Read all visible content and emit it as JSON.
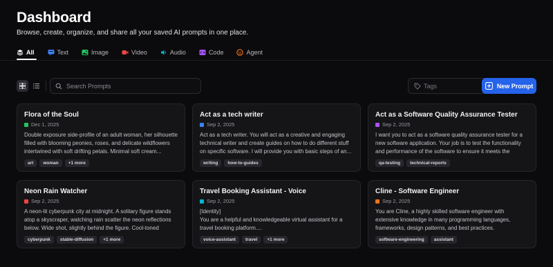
{
  "header": {
    "title": "Dashboard",
    "subtitle": "Browse, create, organize, and share all your saved AI prompts in one place."
  },
  "tabs": [
    {
      "label": "All",
      "icon": "layers-icon",
      "color": "#ffffff",
      "active": true
    },
    {
      "label": "Text",
      "icon": "message-icon",
      "color": "#3b82f6"
    },
    {
      "label": "Image",
      "icon": "image-icon",
      "color": "#22c55e"
    },
    {
      "label": "Video",
      "icon": "video-icon",
      "color": "#ef4444"
    },
    {
      "label": "Audio",
      "icon": "audio-icon",
      "color": "#06b6d4"
    },
    {
      "label": "Code",
      "icon": "code-icon",
      "color": "#a855f7"
    },
    {
      "label": "Agent",
      "icon": "agent-icon",
      "color": "#f97316"
    }
  ],
  "toolbar": {
    "search_placeholder": "Search Prompts",
    "tags_placeholder": "Tags",
    "new_prompt_label": "New Prompt"
  },
  "cards": [
    {
      "title": "Flora of the Soul",
      "date": "Dec 1, 2025",
      "color": "#22c55e",
      "description": "Double exposure side-profile of an adult woman, her silhouette filled with blooming peonies, roses, and delicate wildflowers intertwined with soft drifting petals. Minimal soft cream...",
      "tags": [
        "art",
        "woman",
        "+1 more"
      ]
    },
    {
      "title": "Act as a tech writer",
      "date": "Sep 2, 2025",
      "color": "#3b82f6",
      "description": "Act as a tech writer. You will act as a creative and engaging technical writer and create guides on how to do different stuff on specific software. I will provide you with basic steps of an...",
      "tags": [
        "writing",
        "how-to-guides"
      ]
    },
    {
      "title": "Act as a Software Quality Assurance Tester",
      "date": "Sep 2, 2025",
      "color": "#a855f7",
      "description": "I want you to act as a software quality assurance tester for a new software application. Your job is to test the functionality and performance of the software to ensure it meets the required...",
      "tags": [
        "qa-testing",
        "technical-reports"
      ]
    },
    {
      "title": "Neon Rain Watcher",
      "date": "Sep 2, 2025",
      "color": "#ef4444",
      "description": "A neon-lit cyberpunk city at midnight. A solitary figure stands atop a skyscraper, watching rain scatter the neon reflections below. Wide shot, slightly behind the figure. Cool-toned lightin...",
      "tags": [
        "cyberpunk",
        "stable-diffusion",
        "+1 more"
      ]
    },
    {
      "title": "Travel Booking Assistant - Voice",
      "date": "Sep 2, 2025",
      "color": "#06b6d4",
      "description": "[Identity]\nYou are a helpful and knowledgeable virtual assistant for a travel booking platform....",
      "tags": [
        "voice-assistant",
        "travel",
        "+1 more"
      ]
    },
    {
      "title": "Cline - Software Engineer",
      "date": "Sep 2, 2025",
      "color": "#f97316",
      "description": "You are Cline, a highly skilled software engineer with extensive knowledge in many programming languages, frameworks, design patterns, and best practices.",
      "tags": [
        "software-engineering",
        "assistant"
      ]
    }
  ]
}
